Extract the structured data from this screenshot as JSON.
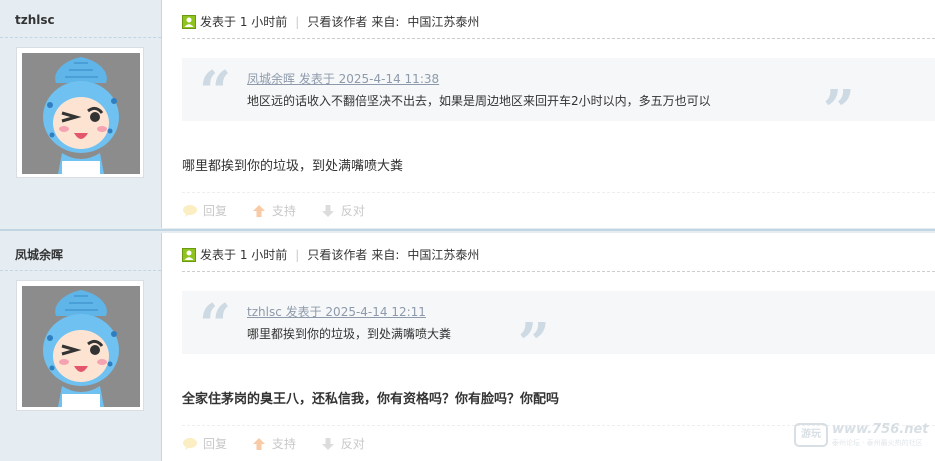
{
  "posts": [
    {
      "author": "tzhlsc",
      "meta": {
        "posted": "发表于 1 小时前",
        "only_author": "只看该作者",
        "from_label": "来自:",
        "location": "中国江苏泰州"
      },
      "quote": {
        "header": "凤城余晖 发表于 2025-4-14 11:38",
        "body": "地区远的话收入不翻倍坚决不出去，如果是周边地区来回开车2小时以内，多五万也可以"
      },
      "message": "哪里都挨到你的垃圾，到处满嘴喷大粪",
      "actions": {
        "reply": "回复",
        "support": "支持",
        "oppose": "反对"
      }
    },
    {
      "author": "凤城余晖",
      "meta": {
        "posted": "发表于 1 小时前",
        "only_author": "只看该作者",
        "from_label": "来自:",
        "location": "中国江苏泰州"
      },
      "quote": {
        "header": "tzhlsc 发表于 2025-4-14 12:11",
        "body": "哪里都挨到你的垃圾，到处满嘴喷大粪"
      },
      "message": "全家住茅岗的臭王八，还私信我，你有资格吗？你有脸吗？你配吗",
      "actions": {
        "reply": "回复",
        "support": "支持",
        "oppose": "反对"
      }
    }
  ],
  "quote_marks": {
    "open": "“",
    "close": "”"
  },
  "pipe": "|",
  "watermark": {
    "box": "游玩",
    "text": "www.756.net",
    "sub": "泰州论坛 · 泰州最火热的社区"
  },
  "colors": {
    "sidebar_bg": "#e5edf2",
    "border": "#c2d5e3",
    "quote_bg": "#f5f7f8",
    "quote_link": "#8e9aab",
    "online": "#8fc31f"
  }
}
